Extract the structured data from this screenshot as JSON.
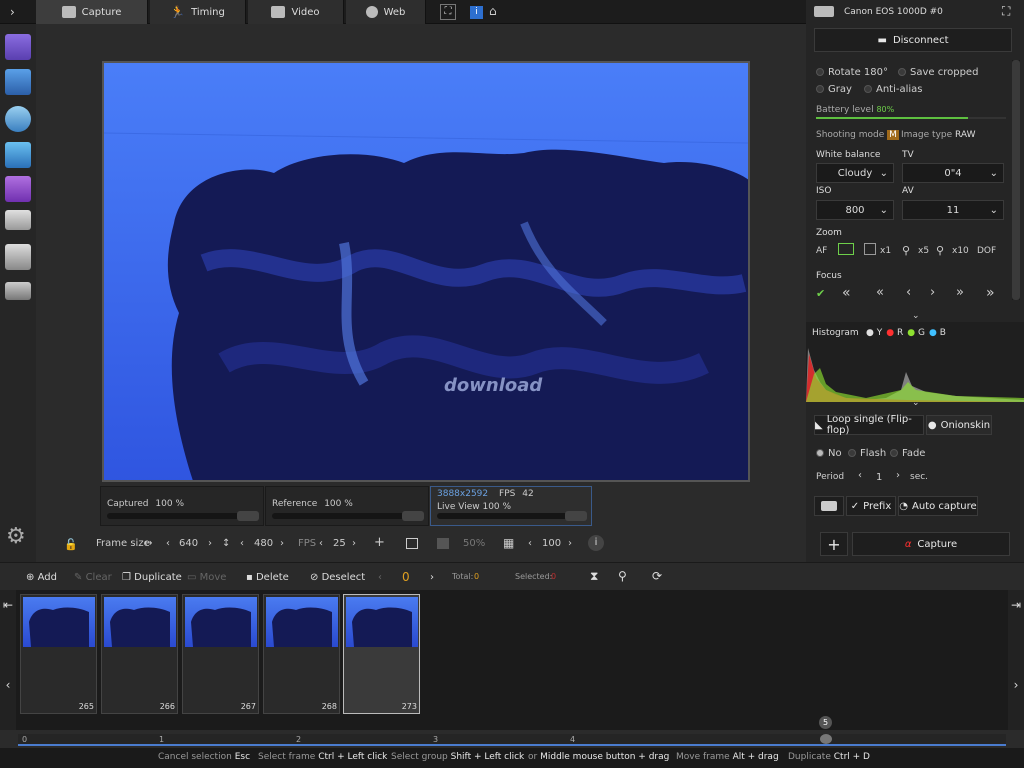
{
  "tabs": [
    {
      "label": "Capture",
      "icon": "camera-icon",
      "active": true
    },
    {
      "label": "Timing",
      "icon": "runner-icon",
      "active": false
    },
    {
      "label": "Video",
      "icon": "film-icon",
      "active": false
    },
    {
      "label": "Web",
      "icon": "globe-icon",
      "active": false
    }
  ],
  "camera": {
    "name": "Canon EOS 1000D #0",
    "disconnect_label": "Disconnect"
  },
  "options": {
    "rotate": "Rotate 180°",
    "save_cropped": "Save cropped",
    "gray": "Gray",
    "anti_alias": "Anti-alias",
    "battery_label": "Battery level",
    "battery_value": "80%",
    "battery_fraction": 0.8,
    "shooting_mode_label": "Shooting mode",
    "shooting_mode_value": "M",
    "image_type_label": "Image type",
    "image_type_value": "RAW",
    "wb_label": "White balance",
    "wb_value": "Cloudy",
    "tv_label": "TV",
    "tv_value": "0\"4",
    "iso_label": "ISO",
    "iso_value": "800",
    "av_label": "AV",
    "av_value": "11",
    "zoom_label": "Zoom",
    "af": "AF",
    "x1": "x1",
    "x5": "x5",
    "x10": "x10",
    "dof": "DOF",
    "focus_label": "Focus"
  },
  "histogram": {
    "label": "Histogram",
    "channels": [
      "Y",
      "R",
      "G",
      "B"
    ],
    "colors": [
      "#e0e0e0",
      "#ff3030",
      "#8ee030",
      "#40c0ff"
    ]
  },
  "loop": {
    "loop_label": "Loop single (Flip-flop)",
    "onion_label": "Onionskin",
    "no": "No",
    "flash": "Flash",
    "fade": "Fade",
    "period_label": "Period",
    "period_value": "1",
    "period_unit": "sec."
  },
  "capture_controls": {
    "prefix": "Prefix",
    "auto_capture": "Auto capture",
    "capture": "Capture"
  },
  "layers": {
    "captured": "Captured",
    "captured_pct": "100",
    "pct_sign": "%",
    "reference": "Reference",
    "reference_pct": "100",
    "resolution": "3888x2592",
    "fps_label": "FPS",
    "fps_value": "42",
    "liveview": "Live View",
    "liveview_pct": "100"
  },
  "frame": {
    "size_label": "Frame size",
    "width": "640",
    "height": "480",
    "fps_label": "FPS",
    "fps": "25",
    "opacity": "50%",
    "zoom": "100"
  },
  "toolbar": {
    "add": "Add",
    "clear": "Clear",
    "duplicate": "Duplicate",
    "move": "Move",
    "delete": "Delete",
    "deselect": "Deselect",
    "current": "0",
    "total_label": "Total:",
    "total": "0",
    "selected_label": "Selected:",
    "selected": "0"
  },
  "frames": [
    "265",
    "266",
    "267",
    "268",
    "273"
  ],
  "timeline": {
    "ticks": [
      "0",
      "1",
      "2",
      "3",
      "4"
    ],
    "marker": "5"
  },
  "watermark": "download",
  "status": [
    {
      "label": "Cancel selection",
      "key": "Esc"
    },
    {
      "label": "Select frame",
      "key": "Ctrl + Left click"
    },
    {
      "label": "Select group",
      "key": "Shift + Left click"
    },
    {
      "label": "or",
      "key": "Middle mouse button + drag"
    },
    {
      "label": "Move frame",
      "key": "Alt + drag"
    },
    {
      "label": "Duplicate",
      "key": "Ctrl + D"
    }
  ]
}
